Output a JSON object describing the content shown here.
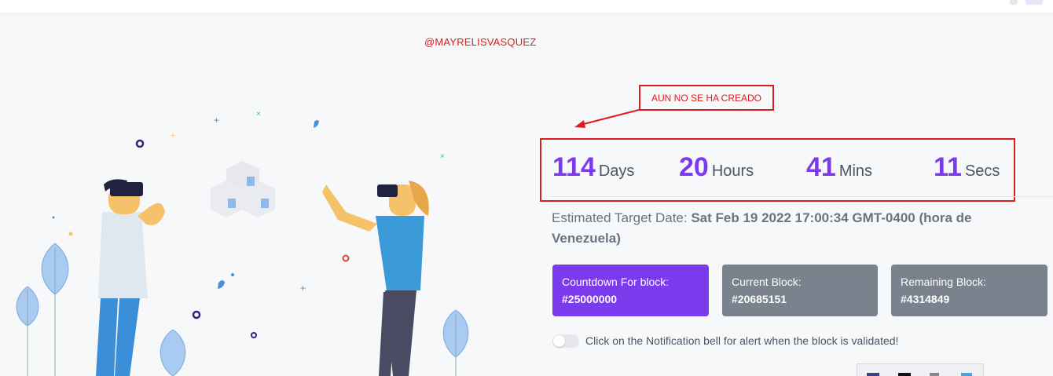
{
  "watermark": "@MAYRELISVASQUEZ",
  "annotation": {
    "note": "AUN NO SE HA CREADO",
    "color": "#e01b1b"
  },
  "countdown": {
    "days": {
      "value": "114",
      "label": "Days"
    },
    "hours": {
      "value": "20",
      "label": "Hours"
    },
    "mins": {
      "value": "41",
      "label": "Mins"
    },
    "secs": {
      "value": "11",
      "label": "Secs"
    }
  },
  "estimated": {
    "label": "Estimated Target Date:",
    "value": "Sat Feb 19 2022 17:00:34 GMT-0400 (hora de Venezuela)"
  },
  "cards": [
    {
      "title": "Countdown For block:",
      "value": "#25000000",
      "color": "#7c3aed"
    },
    {
      "title": "Current Block:",
      "value": "#20685151",
      "color": "#7a828e"
    },
    {
      "title": "Remaining Block:",
      "value": "#4314849",
      "color": "#7a828e"
    }
  ],
  "notification": {
    "text": "Click on the Notification bell for alert when the block is validated!",
    "enabled": false
  },
  "illustration": {
    "icons": [
      "vr-headset-man-icon",
      "vr-headset-woman-icon",
      "cubes-icon",
      "plant-icon"
    ]
  },
  "colors": {
    "accent": "#7c3aed",
    "gray_card": "#7a828e",
    "background": "#f7f8fa"
  }
}
